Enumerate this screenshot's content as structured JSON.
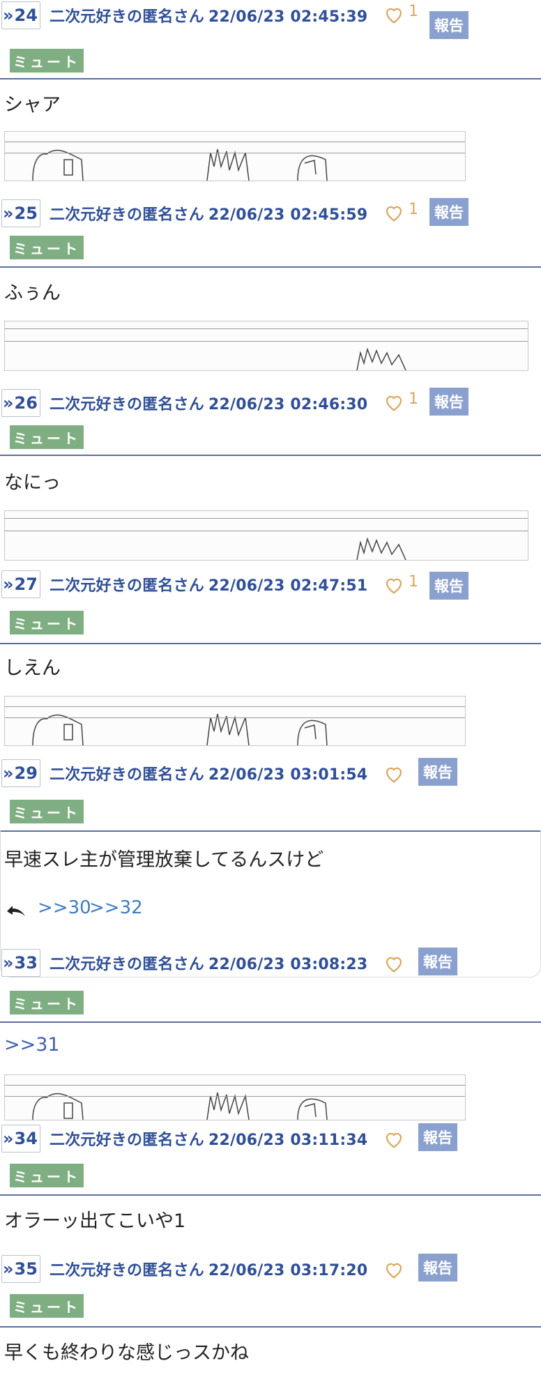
{
  "ui": {
    "report_label": "報告",
    "mute_label": "ミュート",
    "chevron": "»",
    "heart_color": "#d9a860",
    "accent_color": "#2f4f98",
    "mute_color": "#7fae82",
    "report_color": "#8aa0cf"
  },
  "posts": [
    {
      "number": "24",
      "name": "二次元好きの匿名さん",
      "date": "22/06/23 02:45:39",
      "likes": "1",
      "body": "シャア",
      "body_is_link": false,
      "has_image": true
    },
    {
      "number": "25",
      "name": "二次元好きの匿名さん",
      "date": "22/06/23 02:45:59",
      "likes": "1",
      "body": "ふぅん",
      "body_is_link": false,
      "has_image": true
    },
    {
      "number": "26",
      "name": "二次元好きの匿名さん",
      "date": "22/06/23 02:46:30",
      "likes": "1",
      "body": "なにっ",
      "body_is_link": false,
      "has_image": true
    },
    {
      "number": "27",
      "name": "二次元好きの匿名さん",
      "date": "22/06/23 02:47:51",
      "likes": "1",
      "body": "しえん",
      "body_is_link": false,
      "has_image": true
    },
    {
      "number": "29",
      "name": "二次元好きの匿名さん",
      "date": "22/06/23 03:01:54",
      "likes": "",
      "body": "早速スレ主が管理放棄してるんスけど",
      "body_is_link": false,
      "has_image": false,
      "replies": [
        ">>30",
        ">>32"
      ]
    },
    {
      "number": "33",
      "name": "二次元好きの匿名さん",
      "date": "22/06/23 03:08:23",
      "likes": "",
      "body": ">>31",
      "body_is_link": true,
      "has_image": true
    },
    {
      "number": "34",
      "name": "二次元好きの匿名さん",
      "date": "22/06/23 03:11:34",
      "likes": "",
      "body": "オラーッ出てこいや1",
      "body_is_link": false,
      "has_image": false
    },
    {
      "number": "35",
      "name": "二次元好きの匿名さん",
      "date": "22/06/23 03:17:20",
      "likes": "",
      "body": "早くも終わりな感じっスかね",
      "body_is_link": false,
      "has_image": false
    }
  ]
}
